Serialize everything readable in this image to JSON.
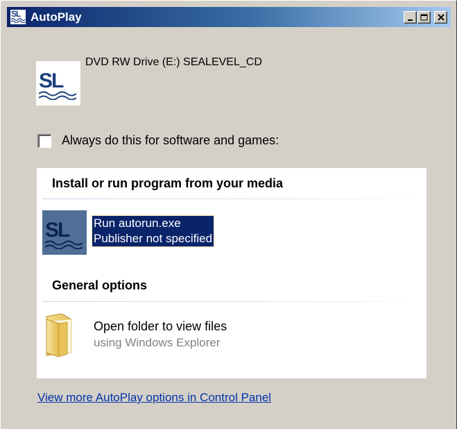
{
  "window": {
    "title": "AutoPlay",
    "app_icon_text": "SL",
    "buttons": {
      "minimize": "minimize-icon",
      "maximize": "maximize-icon",
      "close": "close-icon"
    }
  },
  "device": {
    "icon_text": "SL",
    "label": "DVD RW Drive (E:) SEALEVEL_CD"
  },
  "always_checkbox": {
    "checked": false,
    "label": "Always do this for software and games:"
  },
  "sections": [
    {
      "header": "Install or run program from your media",
      "items": [
        {
          "icon_text": "SL",
          "title": "Run autorun.exe",
          "subtitle": "Publisher not specified",
          "selected": true
        }
      ]
    },
    {
      "header": "General options",
      "items": [
        {
          "icon": "folder-icon",
          "title": "Open folder to view files",
          "subtitle": "using Windows Explorer",
          "selected": false
        }
      ]
    }
  ],
  "control_panel_link": "View more AutoPlay options in Control Panel",
  "colors": {
    "title_gradient_start": "#0a246a",
    "title_gradient_end": "#a6caf0",
    "dialog_background": "#d4d0c8",
    "selection_background": "#0a246a",
    "link": "#0033aa"
  }
}
